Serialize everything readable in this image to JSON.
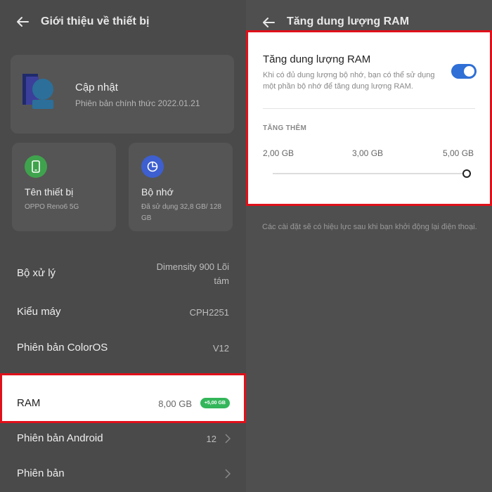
{
  "left": {
    "header": {
      "title": "Giới thiệu về thiết bị"
    },
    "update_card": {
      "title": "Cập nhật",
      "subtitle": "Phiên bản chính thức 2022.01.21"
    },
    "tiles": [
      {
        "title": "Tên thiết bị",
        "subtitle": "OPPO Reno6 5G",
        "icon": "phone-icon",
        "color": "#3fa34d"
      },
      {
        "title": "Bộ nhớ",
        "subtitle": "Đã sử dụng 32,8 GB/ 128 GB",
        "icon": "storage-pie-icon",
        "color": "#3d5fd0"
      }
    ],
    "rows": [
      {
        "label": "Bộ xử lý",
        "value": "Dimensity 900 Lõi tám"
      },
      {
        "label": "Kiểu máy",
        "value": "CPH2251"
      },
      {
        "label": "Phiên bản ColorOS",
        "value": "V12"
      },
      {
        "label": "RAM",
        "value": "8,00 GB",
        "badge": "+5,00 GB"
      },
      {
        "label": "Phiên bản Android",
        "value": "12"
      },
      {
        "label": "Phiên bản",
        "value": ""
      }
    ]
  },
  "right": {
    "header": {
      "title": "Tăng dung lượng RAM"
    },
    "expansion": {
      "title": "Tăng dung lượng RAM",
      "description": "Khi có đủ dung lượng bộ nhớ, bạn có thể sử dụng một phần bộ nhớ để tăng dung lượng RAM.",
      "enabled": true,
      "section_label": "TĂNG THÊM",
      "options": [
        "2,00 GB",
        "3,00 GB",
        "5,00 GB"
      ],
      "selected": "5,00 GB"
    },
    "note": "Các cài đặt sẽ có hiệu lực sau khi bạn khởi động lại điện thoại."
  },
  "colors": {
    "highlight": "#e0101a",
    "toggle_on": "#2f6fd6",
    "badge": "#34b65a"
  }
}
